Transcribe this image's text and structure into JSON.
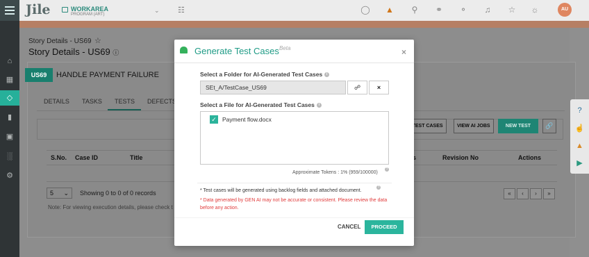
{
  "header": {
    "logo": "Jile",
    "workspace_title": "WORKAREA",
    "workspace_sub": "PROGRAM (ART)",
    "avatar": "AU",
    "icons": [
      "check-circle-icon",
      "warning-icon",
      "search-icon",
      "notification-badge-icon",
      "chat-icon",
      "bell-icon",
      "star-icon",
      "lightbulb-icon"
    ]
  },
  "sidebar": {
    "icons": [
      "home-icon",
      "calendar-icon",
      "layers-icon",
      "book-icon",
      "document-icon",
      "bar-chart-icon",
      "settings-icon"
    ]
  },
  "page": {
    "breadcrumb": "Story Details - US69",
    "title": "Story Details - US69",
    "story_badge": "US69",
    "story_name": "HANDLE PAYMENT FAILURE",
    "tabs": [
      "DETAILS",
      "TASKS",
      "TESTS",
      "DEFECTS"
    ],
    "buttons": {
      "generate": "E TEST CASES",
      "view_ai_jobs": "VIEW AI JOBS",
      "new_test": "NEW TEST"
    },
    "table_headers": [
      "S.No.",
      "Case ID",
      "Title",
      "s",
      "Revision No",
      "Actions"
    ],
    "page_size": "5",
    "showing": "Showing 0 to 0 of 0 records",
    "note": "Note: For viewing execution details, please check t",
    "pager": [
      "«",
      "‹",
      "›",
      "»"
    ]
  },
  "modal": {
    "title": "Generate Test Cases",
    "beta": "Beta",
    "close": "×",
    "folder_label": "Select a Folder for AI-Generated Test Cases",
    "folder_value": "SEt_A/TestCase_US69",
    "file_label": "Select a File for AI-Generated Test Cases",
    "file_name": "Payment flow.docx",
    "tokens": "Approximate Tokens : 1% (959/100000)",
    "note1": "* Test cases will be generated using backlog fields and attached document.",
    "note2": "* Data generated by GEN AI may not be accurate or consistent. Please review the data before any action.",
    "cancel": "CANCEL",
    "proceed": "PROCEED"
  }
}
